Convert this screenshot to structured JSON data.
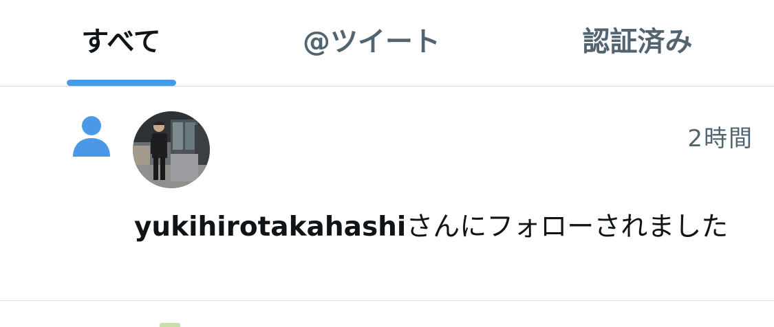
{
  "tabs": [
    {
      "label": "すべて",
      "active": true
    },
    {
      "label": "@ツイート",
      "active": false
    },
    {
      "label": "認証済み",
      "active": false
    }
  ],
  "accent_color": "#4a99e9",
  "notifications": [
    {
      "type": "follow",
      "icon": "person-icon",
      "time": "2時間",
      "username": "yukihirotakahashi",
      "action_text": "さんにフォローされました"
    }
  ]
}
